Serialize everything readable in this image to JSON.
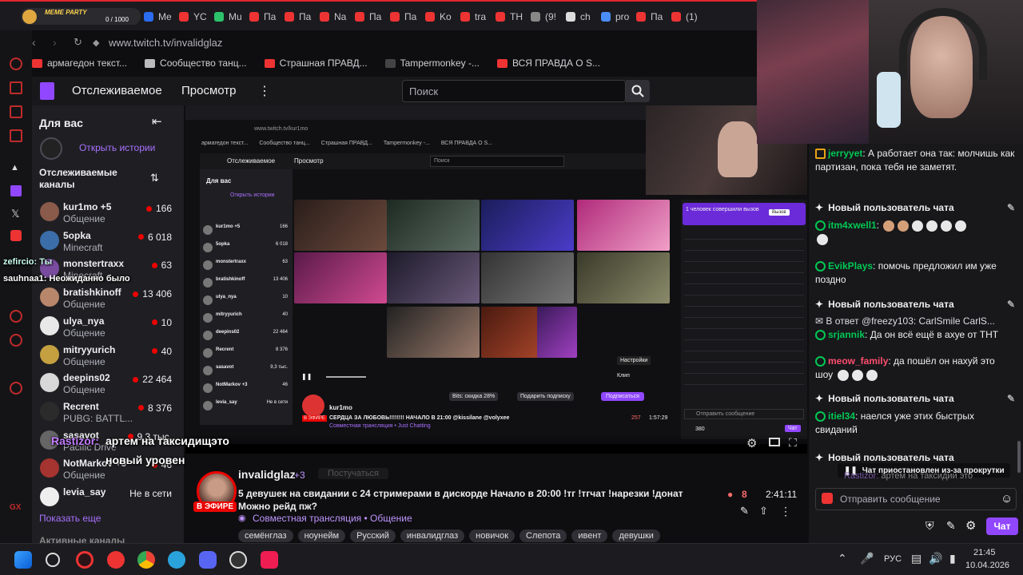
{
  "browser": {
    "meme_widget": {
      "label": "MEME PARTY",
      "progress": "0 / 1000"
    },
    "tabs": [
      "Me",
      "YC",
      "Mu",
      "Па",
      "Па",
      "Na",
      "Па",
      "Па",
      "Ko",
      "tra",
      "TH",
      "(9!",
      "ch",
      "pro",
      "Па",
      "(1)"
    ],
    "url": "www.twitch.tv/invalidglaz",
    "bookmarks": [
      "армагедон текст...",
      "Сообщество танц...",
      "Страшная ПРАВД...",
      "Tampermonkey -...",
      "ВСЯ ПРАВДА О S..."
    ]
  },
  "nav": {
    "following": "Отслеживаемое",
    "browse": "Просмотр",
    "search_placeholder": "Поиск"
  },
  "sidebar": {
    "title": "Для вас",
    "stories": "Открыть истории",
    "followed_header": "Отслеживаемые каналы",
    "channels": [
      {
        "name": "kur1mo +5",
        "game": "Общение",
        "viewers": "166"
      },
      {
        "name": "5opka",
        "game": "Minecraft",
        "viewers": "6 018"
      },
      {
        "name": "monstertraxx",
        "game": "Minecraft",
        "viewers": "63"
      },
      {
        "name": "bratishkinoff",
        "game": "Общение",
        "viewers": "13 406"
      },
      {
        "name": "ulya_nya",
        "game": "Общение",
        "viewers": "10"
      },
      {
        "name": "mitryyurich",
        "game": "Общение",
        "viewers": "40"
      },
      {
        "name": "deepins02",
        "game": "Общение",
        "viewers": "22 464"
      },
      {
        "name": "Recrent",
        "game": "PUBG: BATTL...",
        "viewers": "8 376"
      },
      {
        "name": "sasavot",
        "game": "Pacific Drive",
        "viewers": "9,3 тыс."
      },
      {
        "name": "NotMarkov +3",
        "game": "Общение",
        "viewers": "46"
      },
      {
        "name": "levia_say",
        "game": "",
        "viewers": "Не в сети"
      }
    ],
    "show_more": "Показать еще",
    "active_channels": "Активные каналы"
  },
  "overlay": {
    "chat1": "zefircio: Ты",
    "chat2": "sauhnaa1: Неожиданно было",
    "chat3_user": "Rastizor:",
    "chat3_text": "артем на таксидищэто",
    "chat4": "новый уровень"
  },
  "stream": {
    "channel": "invalidglaz",
    "channel_extra": "+3",
    "follow": "Постучаться",
    "live_badge": "В ЭФИРЕ",
    "title": "5 девушек на свидании с 24 стримерами в дискорде Начало в 20:00 !тг !тгчат !нарезки !донат Можно рейд пж?",
    "category": "Совместная трансляция • Общение",
    "viewers": "8",
    "uptime": "2:41:11",
    "tags": [
      "семёнглаз",
      "ноунейм",
      "Русский",
      "инвалидглаз",
      "новичок",
      "Слепота",
      "ивент",
      "девушки"
    ]
  },
  "nested_stream": {
    "url": "www.twitch.tv/kur1mo",
    "channel": "kur1mo",
    "title": "СЕРДЦА ЗА ЛЮБОВЬ!!!!!!!! НАЧАЛО В 21:00 @kissilane @volyxee",
    "category": "Совместная трансляция • Just Chatting",
    "viewers": "257",
    "uptime": "1:57:29",
    "settings": "Настройки",
    "clip": "Клип",
    "bits": "Bits: скидка 28%",
    "gift": "Подарить подписку",
    "subscribe": "Подписаться",
    "challenge": "1 человек совершили вызов",
    "challenge_btn": "Вызов",
    "send_msg": "Отправить сообщение",
    "chat_btn": "Чат",
    "points": "380",
    "live": "В ЭФИРЕ"
  },
  "chat": {
    "messages": [
      {
        "user": "jerryyet",
        "color": "#00c853",
        "text": "А работает она так: молчишь как партизан, пока тебя не заметят."
      },
      {
        "user": "itm4xwell1",
        "color": "#00c853",
        "text": ""
      },
      {
        "user": "EvikPlays",
        "color": "#00c853",
        "text": "помочь предложил им уже поздно"
      },
      {
        "user": "srjannik",
        "color": "#00c853",
        "text": "Да он всё ещё в ахуе от ТНТ",
        "reply": "В ответ @freezy103: CarlSmile CarlS..."
      },
      {
        "user": "meow_family",
        "color": "#ff4d6d",
        "text": "да пошёл он нахуй это шоу"
      },
      {
        "user": "itiel34",
        "color": "#00c853",
        "text": "наелся уже этих быстрых свиданий"
      }
    ],
    "new_user": "Новый пользователь чата",
    "paused": "Чат приостановлен из-за прокрутки",
    "paused_msg_user": "Rastizor:",
    "paused_msg_text": "артем на таксидии это",
    "input_placeholder": "Отправить сообщение",
    "chat_button": "Чат"
  },
  "taskbar": {
    "lang": "РУС",
    "time": "21:45",
    "date": "10.04.2026"
  }
}
